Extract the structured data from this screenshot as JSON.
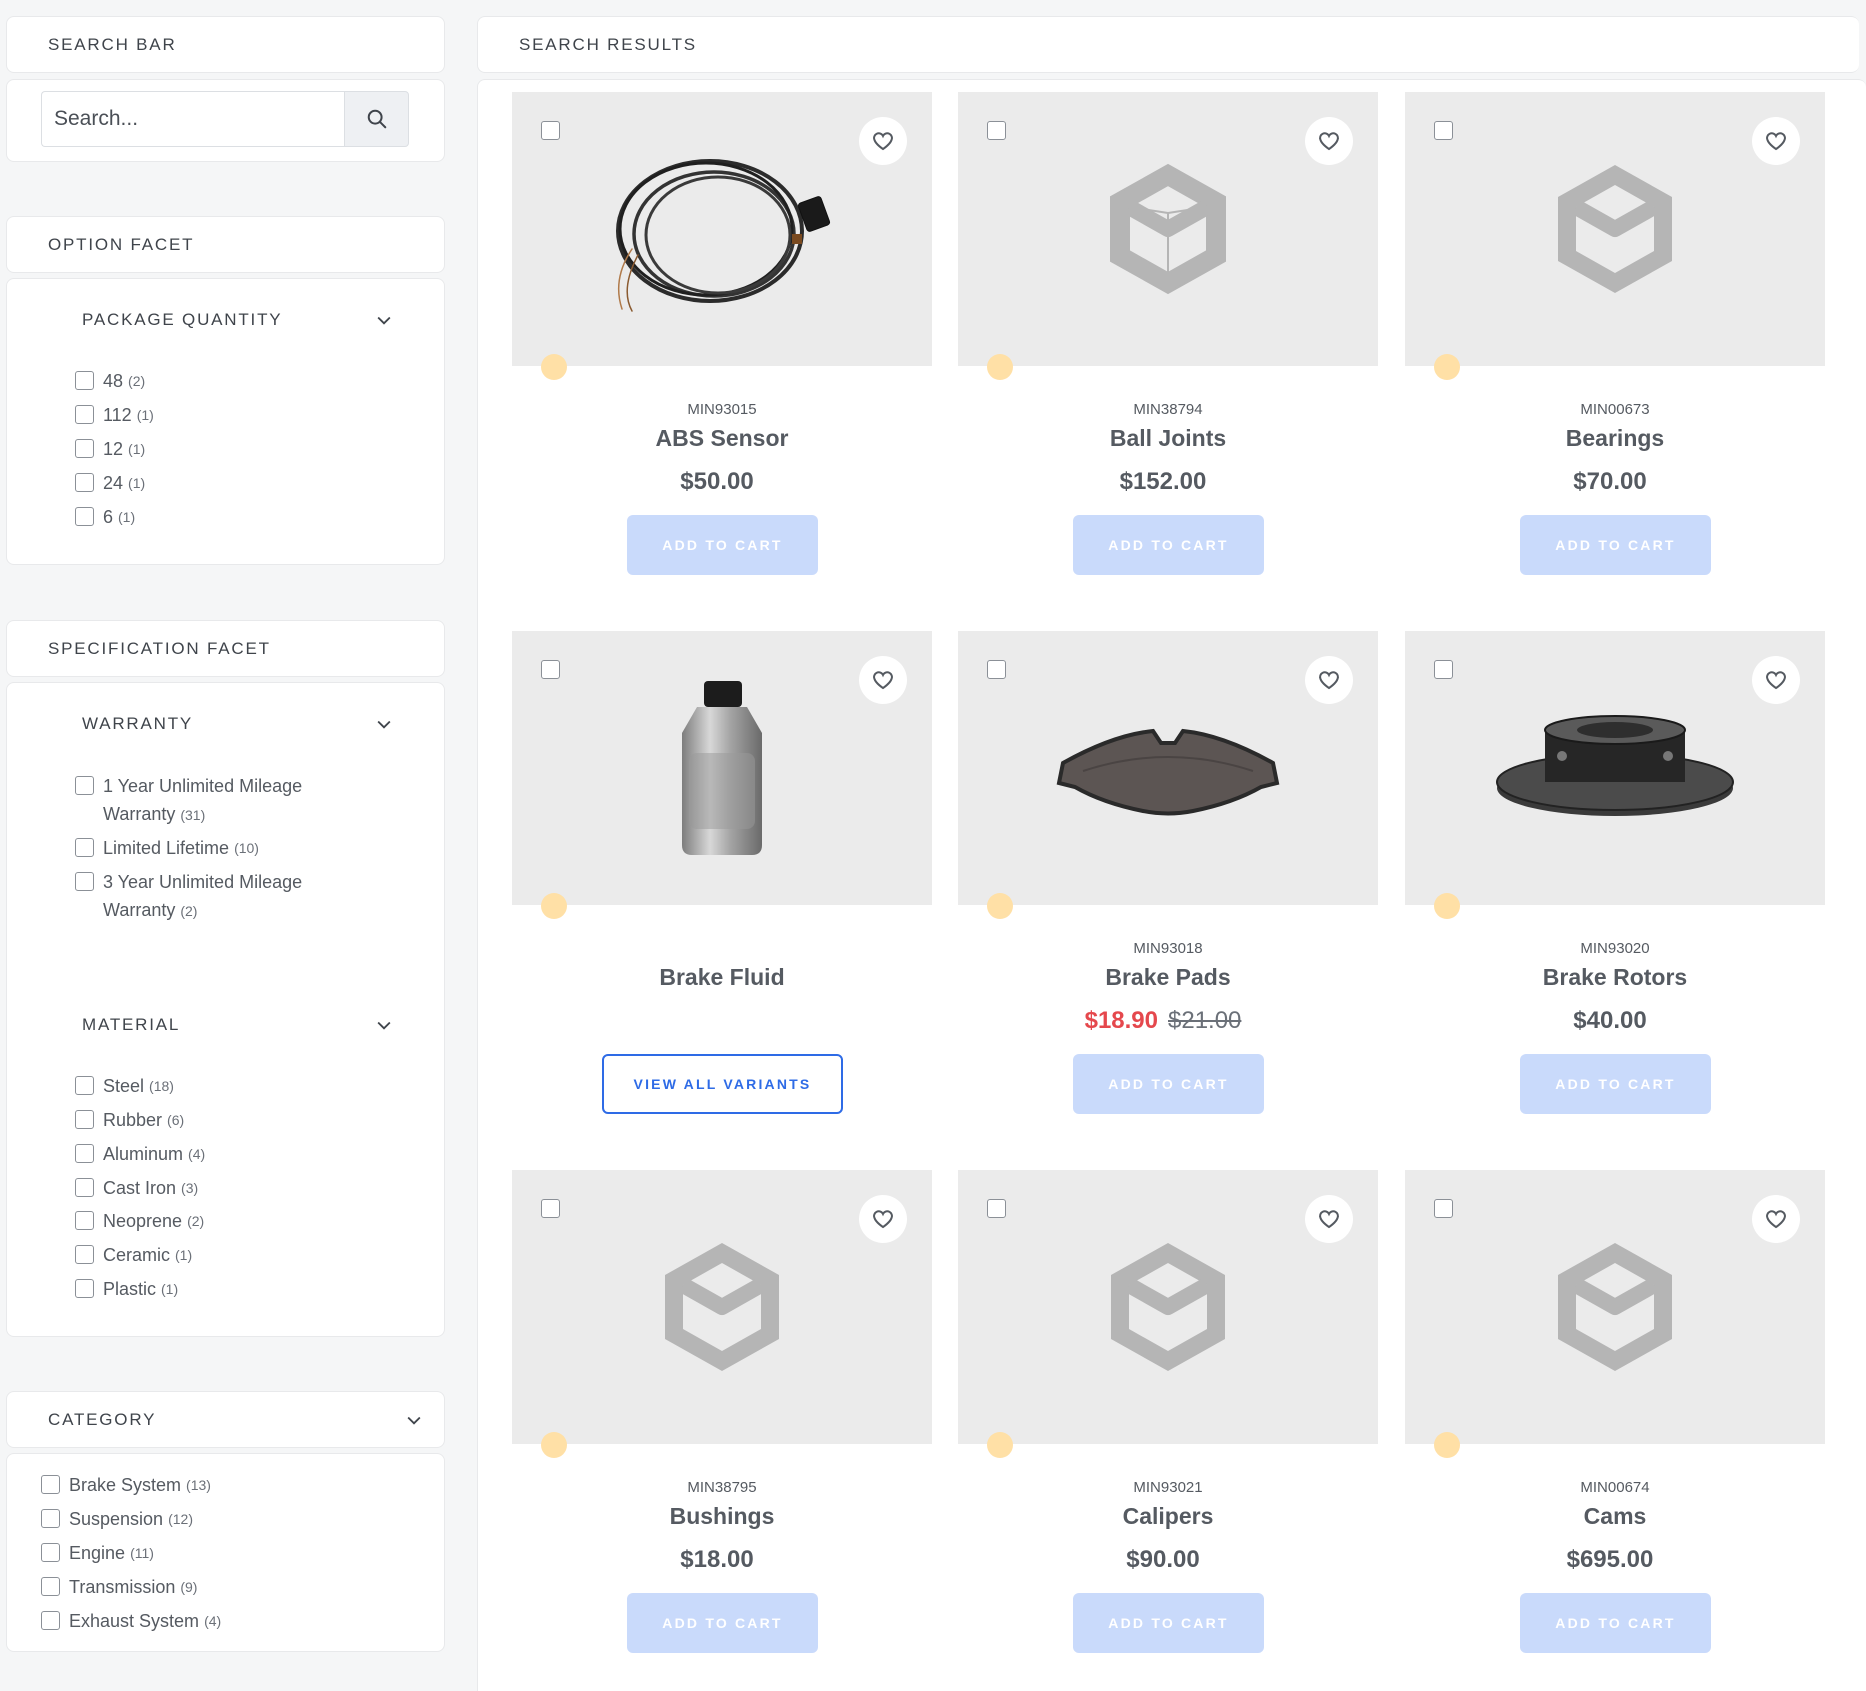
{
  "search_bar": {
    "title": "SEARCH BAR",
    "placeholder": "Search..."
  },
  "option_facet": {
    "title": "OPTION FACET",
    "package_quantity": {
      "title": "PACKAGE QUANTITY",
      "options": [
        {
          "label": "48",
          "count": "(2)"
        },
        {
          "label": "112",
          "count": "(1)"
        },
        {
          "label": "12",
          "count": "(1)"
        },
        {
          "label": "24",
          "count": "(1)"
        },
        {
          "label": "6",
          "count": "(1)"
        }
      ]
    }
  },
  "specification_facet": {
    "title": "SPECIFICATION FACET",
    "warranty": {
      "title": "WARRANTY",
      "options": [
        {
          "label": "1 Year Unlimited Mileage",
          "label2": "Warranty",
          "count": "(31)"
        },
        {
          "label": "Limited Lifetime",
          "count": "(10)"
        },
        {
          "label": "3 Year Unlimited Mileage",
          "label2": "Warranty",
          "count": "(2)"
        }
      ]
    },
    "material": {
      "title": "MATERIAL",
      "options": [
        {
          "label": "Steel",
          "count": "(18)"
        },
        {
          "label": "Rubber",
          "count": "(6)"
        },
        {
          "label": "Aluminum",
          "count": "(4)"
        },
        {
          "label": "Cast Iron",
          "count": "(3)"
        },
        {
          "label": "Neoprene",
          "count": "(2)"
        },
        {
          "label": "Ceramic",
          "count": "(1)"
        },
        {
          "label": "Plastic",
          "count": "(1)"
        }
      ]
    }
  },
  "category": {
    "title": "CATEGORY",
    "options": [
      {
        "label": "Brake System",
        "count": "(13)"
      },
      {
        "label": "Suspension",
        "count": "(12)"
      },
      {
        "label": "Engine",
        "count": "(11)"
      },
      {
        "label": "Transmission",
        "count": "(9)"
      },
      {
        "label": "Exhaust System",
        "count": "(4)"
      }
    ]
  },
  "results": {
    "title": "SEARCH RESULTS",
    "add_to_cart": "ADD TO CART",
    "view_all_variants": "VIEW ALL VARIANTS",
    "products": [
      {
        "sku": "MIN93015",
        "name": "ABS Sensor",
        "price": "$50.00",
        "image": "abs-sensor-cable"
      },
      {
        "sku": "MIN38794",
        "name": "Ball Joints",
        "price": "$152.00",
        "image": "placeholder-box-icon"
      },
      {
        "sku": "MIN00673",
        "name": "Bearings",
        "price": "$70.00",
        "image": "placeholder-box-icon"
      },
      {
        "sku": "",
        "name": "Brake Fluid",
        "price": "",
        "image": "brake-fluid-bottle"
      },
      {
        "sku": "MIN93018",
        "name": "Brake Pads",
        "sale_price": "$18.90",
        "was_price": "$21.00",
        "image": "brake-pad"
      },
      {
        "sku": "MIN93020",
        "name": "Brake Rotors",
        "price": "$40.00",
        "image": "brake-rotor"
      },
      {
        "sku": "MIN38795",
        "name": "Bushings",
        "price": "$18.00",
        "image": "placeholder-box-icon"
      },
      {
        "sku": "MIN93021",
        "name": "Calipers",
        "price": "$90.00",
        "image": "placeholder-box-icon"
      },
      {
        "sku": "MIN00674",
        "name": "Cams",
        "price": "$695.00",
        "image": "placeholder-box-icon"
      }
    ]
  },
  "colors": {
    "add_to_cart_bg": "#c9dafb",
    "accent_blue": "#2e6be6",
    "sale_red": "#e5484d",
    "badge_dot": "#ffe0a6",
    "image_bg": "#ebebeb"
  }
}
